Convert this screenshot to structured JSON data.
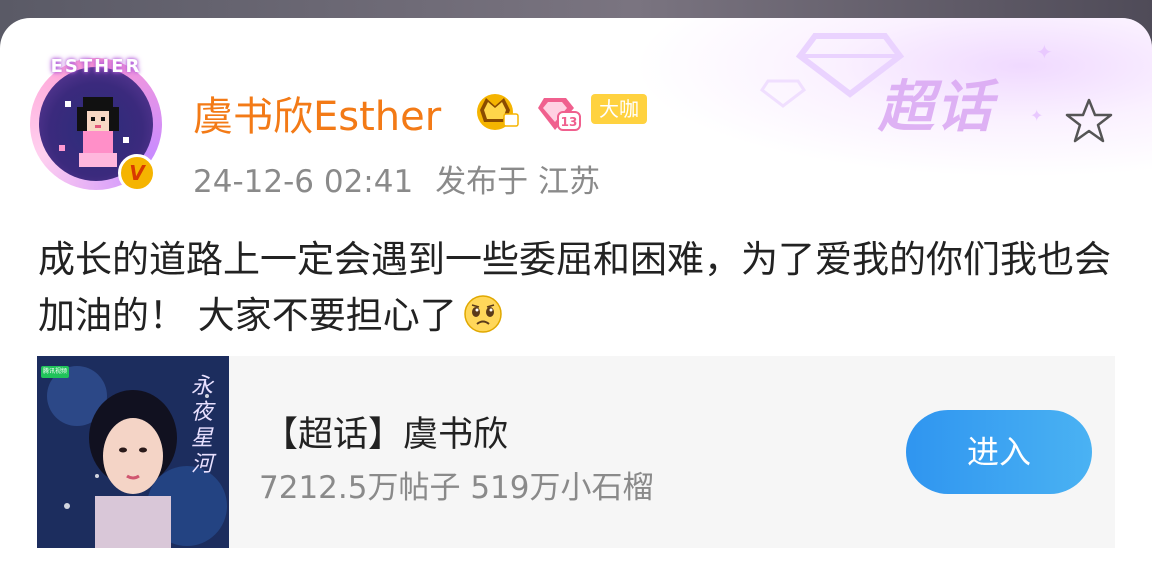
{
  "post": {
    "username": "虞书欣Esther",
    "avatar_text": "ESTHER",
    "level": "13",
    "daka_label": "大咖",
    "verified_mark": "V",
    "timestamp": "24-12-6 02:41",
    "location": "发布于 江苏",
    "text": "成长的道路上一定会遇到一些委屈和困难，为了爱我的你们我也会加油的！ 大家不要担心了",
    "emoji": "crying-face-emoji",
    "watermark": "超话"
  },
  "topic": {
    "title": "【超话】虞书欣",
    "stats": "7212.5万帖子 519万小石榴",
    "enter_label": "进入",
    "thumb_poster_text": "永夜星河",
    "thumb_logo_text": "腾讯视频"
  },
  "colors": {
    "username": "#f37a16",
    "enter_button": "#3aa3f2",
    "daka_badge": "#ffd23f",
    "meta_text": "#8a8a8a"
  },
  "icons": {
    "favorite": "star-outline-icon",
    "crown": "crown-badge-icon",
    "level": "gem-level-icon",
    "verified": "verified-v-icon"
  }
}
